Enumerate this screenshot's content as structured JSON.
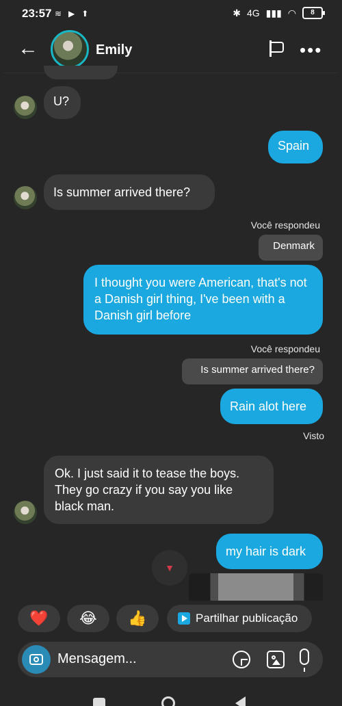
{
  "status_bar": {
    "time": "23:57",
    "network": "4G",
    "battery": "8"
  },
  "header": {
    "contact_name": "Emily"
  },
  "messages": {
    "m1": "U?",
    "m2": "Spain",
    "m3": "Is summer arrived there?",
    "reply_label_1": "Você respondeu",
    "quoted_1": "Denmark",
    "m4": "I thought you were American, that's not a Danish girl thing, I've been with a Danish girl before",
    "reply_label_2": "Você respondeu",
    "quoted_2": "Is summer arrived there?",
    "m5": "Rain alot here",
    "seen": "Visto",
    "m6": "Ok. I just said it to tease the boys. They go crazy if you say you like black man.",
    "m7": "my hair is dark"
  },
  "quick_reactions": {
    "heart": "❤️",
    "laugh": "😂",
    "thumbs": "👍"
  },
  "share": {
    "label": "Partilhar publicação"
  },
  "composer": {
    "placeholder": "Mensagem..."
  },
  "icons": {
    "back": "back-arrow-icon",
    "flag": "flag-icon",
    "more": "more-icon",
    "camera": "camera-icon",
    "sticker": "sticker-icon",
    "gallery": "gallery-icon",
    "mic": "microphone-icon"
  },
  "colors": {
    "outgoing_bubble": "#1ba8e1",
    "incoming_bubble": "#3a3a3a",
    "background": "#262626"
  }
}
